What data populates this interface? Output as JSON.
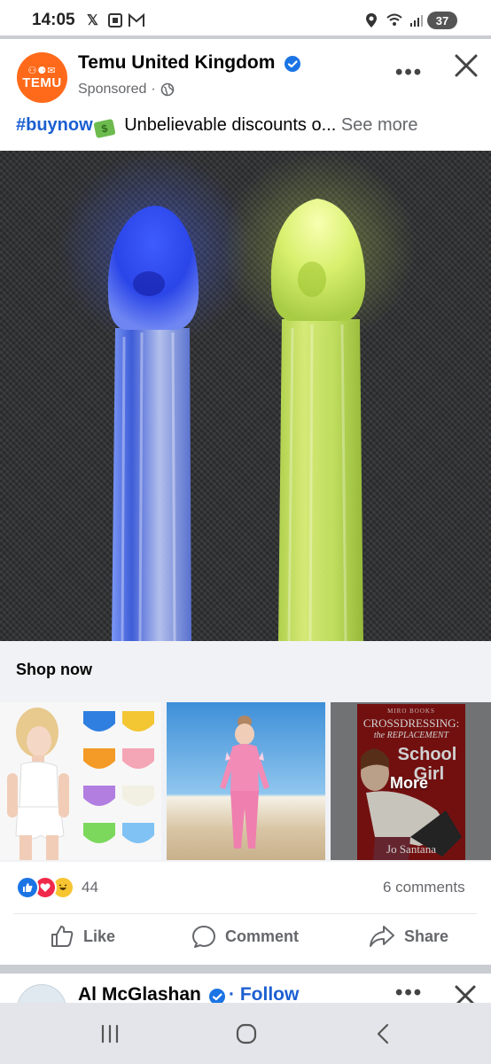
{
  "status_bar": {
    "time": "14:05",
    "battery": "37"
  },
  "post": {
    "avatar_glyphs": "⚇⚈✉",
    "avatar_text": "TEMU",
    "page_name": "Temu United Kingdom",
    "sponsored": "Sponsored",
    "caption": {
      "hashtag": "#buynow",
      "money_emoji": "$",
      "text": "Unbelievable discounts o...",
      "see_more": "See more"
    },
    "shop_now": "Shop now",
    "carousel_more": "More",
    "book_cover": {
      "publisher": "MIRO BOOKS",
      "title_line1": "CROSSDRESSING:",
      "title_line2": "the REPLACEMENT",
      "title_line3": "School",
      "title_line4": "Girl",
      "author": "Jo Santana"
    },
    "reaction_count": "44",
    "comments_count": "6 comments",
    "actions": {
      "like": "Like",
      "comment": "Comment",
      "share": "Share"
    }
  },
  "next_post": {
    "name": "Al McGlashan",
    "follow": "· Follow"
  },
  "colors": {
    "accent_blue": "#1b5fd1",
    "temu_orange": "#ff6a1a",
    "muted": "#65676b"
  }
}
